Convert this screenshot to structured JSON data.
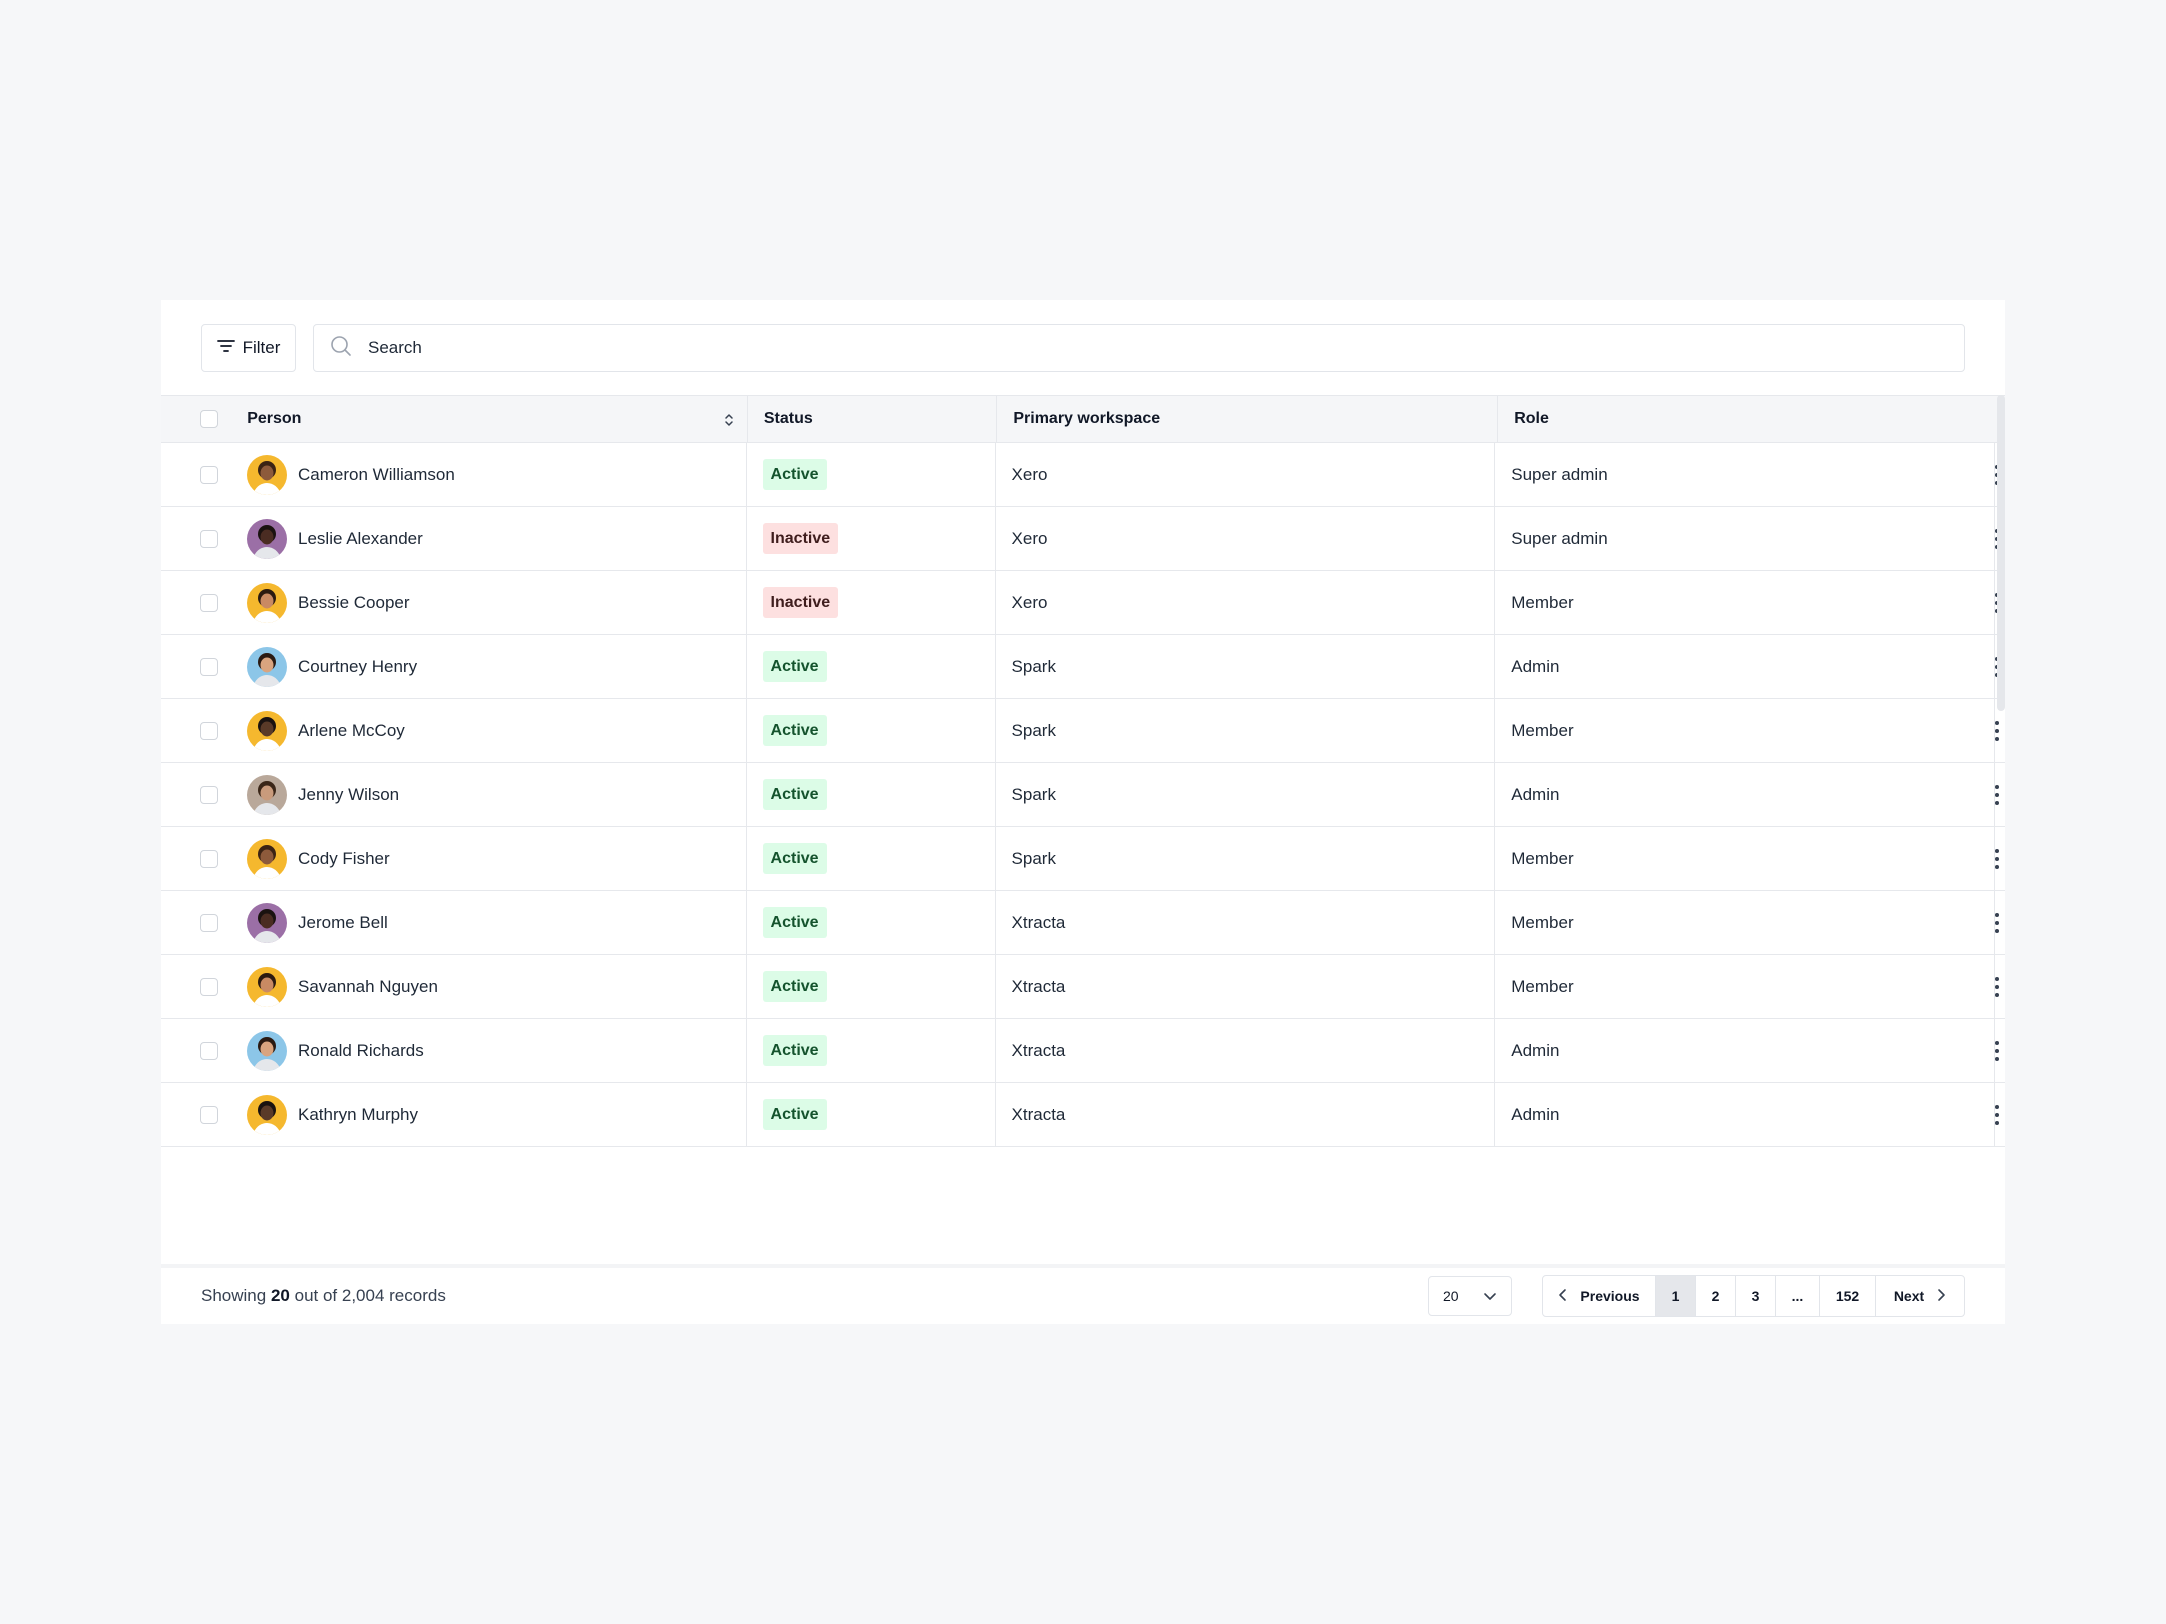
{
  "toolbar": {
    "filter_label": "Filter",
    "search_placeholder": "Search"
  },
  "table": {
    "columns": {
      "person": "Person",
      "status": "Status",
      "workspace": "Primary workspace",
      "role": "Role"
    },
    "rows": [
      {
        "name": "Cameron Williamson",
        "status": "Active",
        "workspace": "Xero",
        "role": "Super admin",
        "avatar_bg": "#f5b82e",
        "skin": "#8d5a3b",
        "hair": "#3b2314"
      },
      {
        "name": "Leslie Alexander",
        "status": "Inactive",
        "workspace": "Xero",
        "role": "Super admin",
        "avatar_bg": "#9b6fa6",
        "skin": "#4a2c22",
        "hair": "#1a1210"
      },
      {
        "name": "Bessie Cooper",
        "status": "Inactive",
        "workspace": "Xero",
        "role": "Member",
        "avatar_bg": "#f5b82e",
        "skin": "#c98a63",
        "hair": "#2b1a10"
      },
      {
        "name": "Courtney Henry",
        "status": "Active",
        "workspace": "Spark",
        "role": "Admin",
        "avatar_bg": "#8cc6e8",
        "skin": "#d9a47f",
        "hair": "#2a1a12"
      },
      {
        "name": "Arlene McCoy",
        "status": "Active",
        "workspace": "Spark",
        "role": "Member",
        "avatar_bg": "#f5b82e",
        "skin": "#5a3a28",
        "hair": "#1a1210"
      },
      {
        "name": "Jenny Wilson",
        "status": "Active",
        "workspace": "Spark",
        "role": "Admin",
        "avatar_bg": "#b9a89a",
        "skin": "#c99b7c",
        "hair": "#3a2618"
      },
      {
        "name": "Cody Fisher",
        "status": "Active",
        "workspace": "Spark",
        "role": "Member",
        "avatar_bg": "#f5b82e",
        "skin": "#8d5a3b",
        "hair": "#3b2314"
      },
      {
        "name": "Jerome Bell",
        "status": "Active",
        "workspace": "Xtracta",
        "role": "Member",
        "avatar_bg": "#9b6fa6",
        "skin": "#4a2c22",
        "hair": "#1a1210"
      },
      {
        "name": "Savannah Nguyen",
        "status": "Active",
        "workspace": "Xtracta",
        "role": "Member",
        "avatar_bg": "#f5b82e",
        "skin": "#c98a63",
        "hair": "#2b1a10"
      },
      {
        "name": "Ronald Richards",
        "status": "Active",
        "workspace": "Xtracta",
        "role": "Admin",
        "avatar_bg": "#8cc6e8",
        "skin": "#d9a47f",
        "hair": "#2a1a12"
      },
      {
        "name": "Kathryn Murphy",
        "status": "Active",
        "workspace": "Xtracta",
        "role": "Admin",
        "avatar_bg": "#f5b82e",
        "skin": "#5a3a28",
        "hair": "#1a1210"
      }
    ]
  },
  "footer": {
    "showing_prefix": "Showing",
    "showing_count": "20",
    "showing_suffix": "out of 2,004 records",
    "page_size": "20",
    "previous_label": "Previous",
    "next_label": "Next",
    "pages": [
      "1",
      "2",
      "3",
      "...",
      "152"
    ],
    "current_page": "1"
  },
  "colors": {
    "active_bg": "#dcfce7",
    "inactive_bg": "#fde0e0",
    "page_bg": "#f6f7f9"
  }
}
